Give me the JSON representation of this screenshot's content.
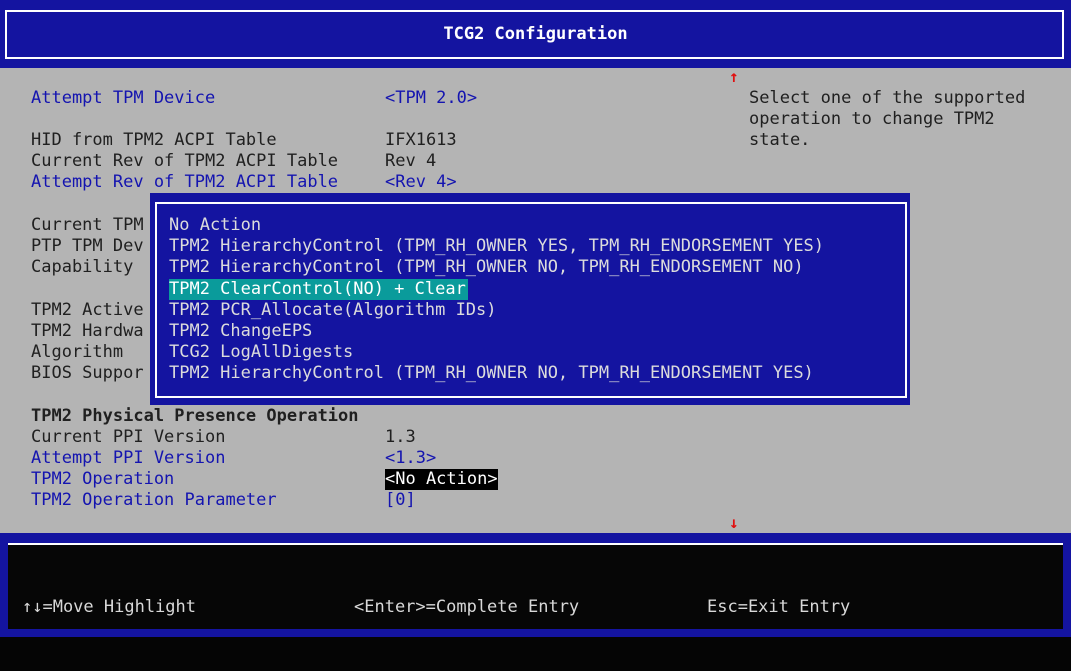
{
  "title": "TCG2 Configuration",
  "help_text": "Select one of the supported\noperation to change TPM2\nstate.",
  "settings": [
    {
      "label": "Attempt TPM Device",
      "value": "<TPM 2.0>"
    },
    {
      "label": "HID from TPM2 ACPI Table",
      "value": "IFX1613"
    },
    {
      "label": "Current Rev of TPM2 ACPI Table",
      "value": "Rev 4"
    },
    {
      "label": "Attempt Rev of TPM2 ACPI Table",
      "value": "<Rev 4>"
    },
    {
      "label": "Current TPM"
    },
    {
      "label": "PTP TPM Dev"
    },
    {
      "label": "Capability"
    },
    {
      "label": "TPM2 Active"
    },
    {
      "label": "TPM2 Hardwa"
    },
    {
      "label": "Algorithm"
    },
    {
      "label": "BIOS Suppor"
    },
    {
      "label": "TPM2 Physical Presence Operation"
    },
    {
      "label": "Current PPI Version",
      "value": "1.3"
    },
    {
      "label": "Attempt PPI Version",
      "value": "<1.3>"
    },
    {
      "label": "TPM2 Operation",
      "value": "<No Action>"
    },
    {
      "label": "TPM2 Operation Parameter",
      "value": "[0]"
    }
  ],
  "popup": {
    "options": [
      "No Action",
      "TPM2 HierarchyControl (TPM_RH_OWNER YES, TPM_RH_ENDORSEMENT YES)",
      "TPM2 HierarchyControl (TPM_RH_OWNER NO, TPM_RH_ENDORSEMENT NO)",
      "TPM2 ClearControl(NO) + Clear",
      "TPM2 PCR_Allocate(Algorithm IDs)",
      "TPM2 ChangeEPS",
      "TCG2 LogAllDigests",
      "TPM2 HierarchyControl (TPM_RH_OWNER NO, TPM_RH_ENDORSEMENT YES)"
    ],
    "selected_index": 3
  },
  "scroll": {
    "up": "↑",
    "down": "↓"
  },
  "footer": {
    "move": "↑↓=Move Highlight",
    "enter": "<Enter>=Complete Entry",
    "esc": "Esc=Exit Entry"
  },
  "colors": {
    "header_bg": "#1414a0",
    "main_bg": "#b4b4b4",
    "label_blue": "#1414b0",
    "highlight": "#0a9b9b",
    "arrow_red": "#e01010"
  }
}
